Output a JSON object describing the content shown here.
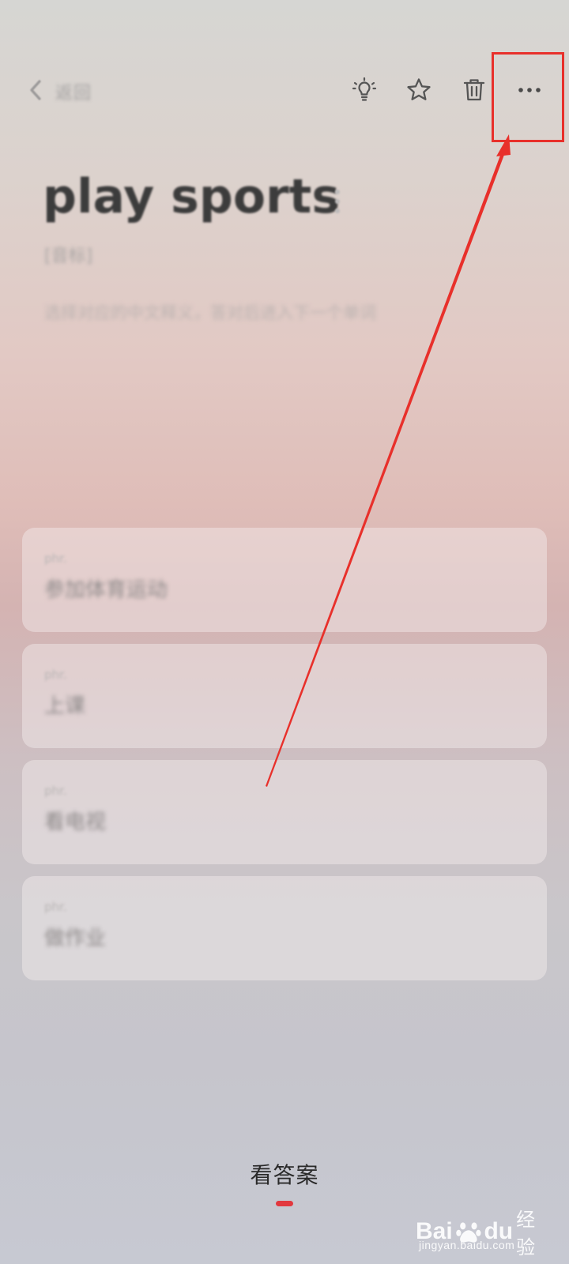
{
  "header": {
    "back_label": "返回",
    "icons": [
      "lightbulb-icon",
      "star-icon",
      "trash-icon",
      "more-icon"
    ]
  },
  "word": {
    "text": "play sports",
    "phonetic": "[音标]",
    "hint": "选择对应的中文释义，答对后进入下一个单词"
  },
  "options": [
    {
      "pos": "phr.",
      "meaning": "参加体育运动"
    },
    {
      "pos": "phr.",
      "meaning": "上课"
    },
    {
      "pos": "phr.",
      "meaning": "看电视"
    },
    {
      "pos": "phr.",
      "meaning": "做作业"
    }
  ],
  "footer": {
    "answer_label": "看答案"
  },
  "colors": {
    "annotation_red": "#e8302b",
    "accent_red": "#e2383e"
  },
  "watermark": {
    "brand_left": "Bai",
    "brand_right": "du",
    "brand_cn": "经验",
    "url": "jingyan.baidu.com"
  }
}
